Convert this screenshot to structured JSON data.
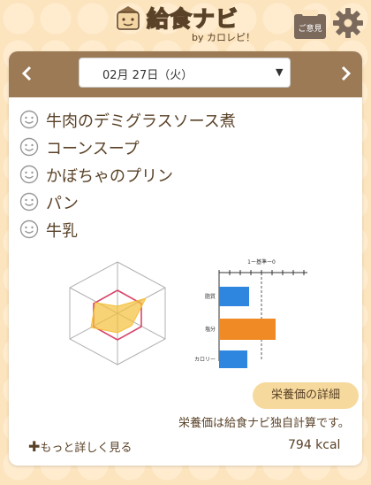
{
  "header": {
    "logo_text": "給食ナビ",
    "logo_sub": "by カロレピ！",
    "opinion_label": "ご意見"
  },
  "date_selector": {
    "value": "02月 27日（火）"
  },
  "menu": {
    "items": [
      {
        "label": "牛肉のデミグラスソース煮"
      },
      {
        "label": "コーンスープ"
      },
      {
        "label": "かぼちゃのプリン"
      },
      {
        "label": "パン"
      },
      {
        "label": "牛乳"
      }
    ]
  },
  "bar_chart": {
    "title": "1ー基準ー0",
    "categories": [
      "脂質",
      "塩分",
      "カロリー"
    ],
    "colors": [
      "#2e86de",
      "#f08a24",
      "#2e86de"
    ]
  },
  "radar_chart": {
    "fill_color": "#f5c13a",
    "outline_color": "#d9456a"
  },
  "detail_button": "栄養価の詳細",
  "note": "栄養価は給食ナビ独自計算です。",
  "more_link": "もっと詳しく見る",
  "calories": "794 kcal",
  "colors": {
    "bar_header": "#9b7a55",
    "text": "#5a4228",
    "background": "#fbe4be",
    "button": "#f6d99d"
  }
}
